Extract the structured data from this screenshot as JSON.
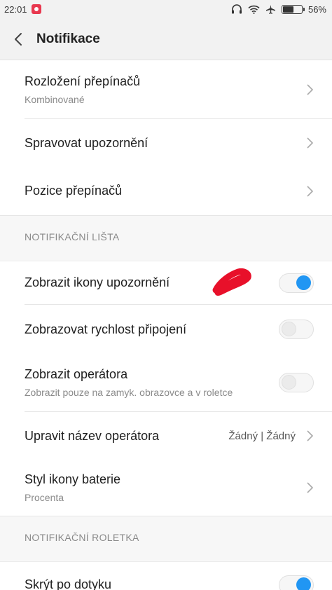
{
  "status_bar": {
    "time": "22:01",
    "app_icon": "tiktok-icon",
    "icons": [
      "headphones-icon",
      "wifi-icon",
      "airplane-icon",
      "battery-icon"
    ],
    "battery_percent": "56%",
    "battery_level": 0.56
  },
  "header": {
    "back_icon": "back-arrow-icon",
    "title": "Notifikace"
  },
  "group1": {
    "items": [
      {
        "label": "Rozložení přepínačů",
        "sub": "Kombinované"
      },
      {
        "label": "Spravovat upozornění"
      },
      {
        "label": "Pozice přepínačů"
      }
    ]
  },
  "section_notification_bar": {
    "header": "NOTIFIKAČNÍ LIŠTA",
    "items": [
      {
        "label": "Zobrazit ikony upozornění",
        "toggle": true
      },
      {
        "label": "Zobrazovat rychlost připojení",
        "toggle": false
      },
      {
        "label": "Zobrazit operátora",
        "sub": "Zobrazit pouze na zamyk. obrazovce a v roletce",
        "toggle": false
      },
      {
        "label": "Upravit název operátora",
        "value": "Žádný | Žádný"
      },
      {
        "label": "Styl ikony baterie",
        "sub": "Procenta"
      }
    ]
  },
  "section_notification_shade": {
    "header": "NOTIFIKAČNÍ ROLETKA",
    "items": [
      {
        "label": "Skrýt po dotyku",
        "toggle": true
      }
    ]
  },
  "colors": {
    "accent": "#2196f3",
    "annotation": "#e8102a"
  }
}
